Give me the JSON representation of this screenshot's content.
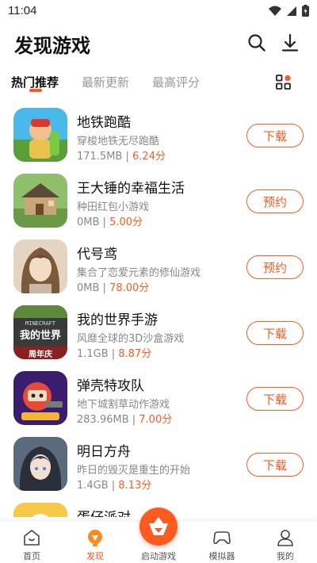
{
  "status": {
    "time": "11:04"
  },
  "header": {
    "title": "发现游戏"
  },
  "tabs": [
    {
      "label": "热门推荐",
      "active": true
    },
    {
      "label": "最新更新",
      "active": false
    },
    {
      "label": "最高评分",
      "active": false
    }
  ],
  "games": [
    {
      "name": "地铁跑酷",
      "desc": "穿梭地铁无尽跑酷",
      "size": "171.5MB",
      "separator": " | ",
      "score": "6.24分",
      "action": "下载",
      "icon": "subway-surfers-icon"
    },
    {
      "name": "王大锤的幸福生活",
      "desc": "种田红包小游戏",
      "size": "0MB",
      "separator": " | ",
      "score": "5.00分",
      "action": "预约",
      "icon": "farm-house-icon"
    },
    {
      "name": "代号鸢",
      "desc": "集合了恋爱元素的修仙游戏",
      "size": "0MB",
      "separator": " | ",
      "score": "78.00分",
      "action": "预约",
      "icon": "anime-character-icon"
    },
    {
      "name": "我的世界手游",
      "desc": "风靡全球的3D沙盒游戏",
      "size": "1.1GB",
      "separator": " | ",
      "score": "8.87分",
      "action": "下载",
      "icon": "minecraft-icon",
      "icon_text_1": "MINECRAFT",
      "icon_text_2": "我的世界",
      "icon_text_3": "周年庆"
    },
    {
      "name": "弹壳特攻队",
      "desc": "地下城割草动作游戏",
      "size": "283.96MB",
      "separator": " | ",
      "score": "7.00分",
      "action": "下载",
      "icon": "survivor-icon"
    },
    {
      "name": "明日方舟",
      "desc": "昨日的毁灭是重生的开始",
      "size": "1.4GB",
      "separator": " | ",
      "score": "8.13分",
      "action": "下载",
      "icon": "arknights-icon"
    },
    {
      "name": "蛋仔派对",
      "desc": "",
      "size": "",
      "separator": "",
      "score": "",
      "action": "",
      "icon": "eggy-party-icon"
    }
  ],
  "nav": [
    {
      "label": "首页",
      "icon": "home-icon",
      "active": false
    },
    {
      "label": "发现",
      "icon": "discover-icon",
      "active": true
    },
    {
      "label": "启动游戏",
      "icon": "launch-game-icon",
      "active": false
    },
    {
      "label": "模拟器",
      "icon": "gamepad-icon",
      "active": false
    },
    {
      "label": "我的",
      "icon": "profile-icon",
      "active": false
    }
  ],
  "colors": {
    "accent": "#ff5a1f"
  }
}
